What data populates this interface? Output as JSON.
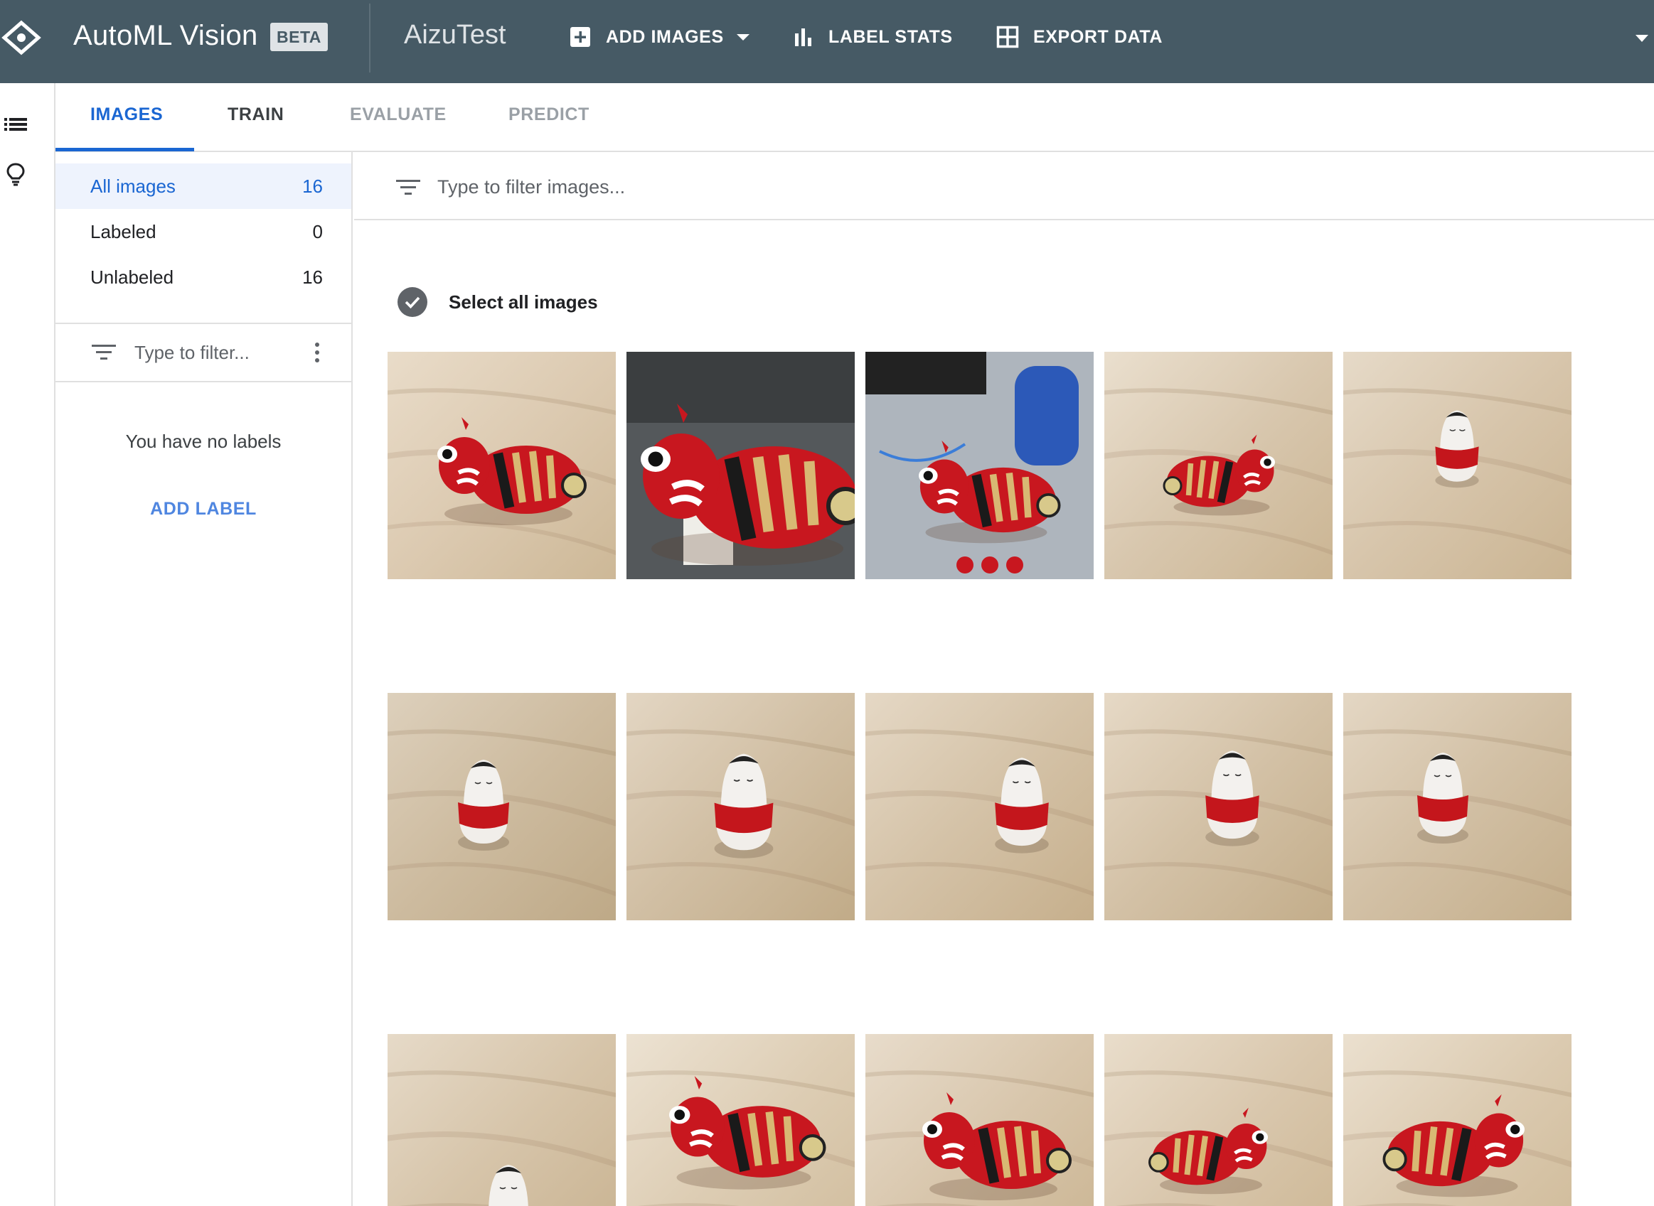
{
  "header": {
    "app_title": "AutoML Vision",
    "beta_badge": "BETA",
    "project_name": "AizuTest",
    "actions": {
      "add_images": "ADD IMAGES",
      "label_stats": "LABEL STATS",
      "export_data": "EXPORT DATA"
    },
    "bar_color": "#465a65"
  },
  "rail": {
    "icons": [
      "list-icon",
      "lightbulb-icon"
    ]
  },
  "tabs": {
    "images": "IMAGES",
    "train": "TRAIN",
    "evaluate": "EVALUATE",
    "predict": "PREDICT",
    "active": "IMAGES"
  },
  "sidebar": {
    "filters": [
      {
        "label": "All images",
        "count": "16"
      },
      {
        "label": "Labeled",
        "count": "0"
      },
      {
        "label": "Unlabeled",
        "count": "16"
      }
    ],
    "label_filter_placeholder": "Type to filter...",
    "empty_text": "You have no labels",
    "add_label": "ADD LABEL"
  },
  "main": {
    "filter_placeholder": "Type to filter images...",
    "select_all": "Select all images",
    "images": [
      {
        "subject": "red-cow-figurine"
      },
      {
        "subject": "red-cow-mask-closeup"
      },
      {
        "subject": "red-cow-with-electronics"
      },
      {
        "subject": "red-cow-figurine-front"
      },
      {
        "subject": "kokeshi-doll"
      },
      {
        "subject": "kokeshi-doll"
      },
      {
        "subject": "kokeshi-doll"
      },
      {
        "subject": "kokeshi-doll"
      },
      {
        "subject": "kokeshi-doll"
      },
      {
        "subject": "kokeshi-doll"
      },
      {
        "subject": "kokeshi-doll"
      },
      {
        "subject": "red-cow-figurine"
      },
      {
        "subject": "red-cow-figurine"
      },
      {
        "subject": "red-cow-figurine"
      },
      {
        "subject": "red-cow-figurine"
      }
    ]
  },
  "colors": {
    "accent": "#1a66d2",
    "link": "#4f86e0",
    "active_row_bg": "#eef3fd"
  }
}
